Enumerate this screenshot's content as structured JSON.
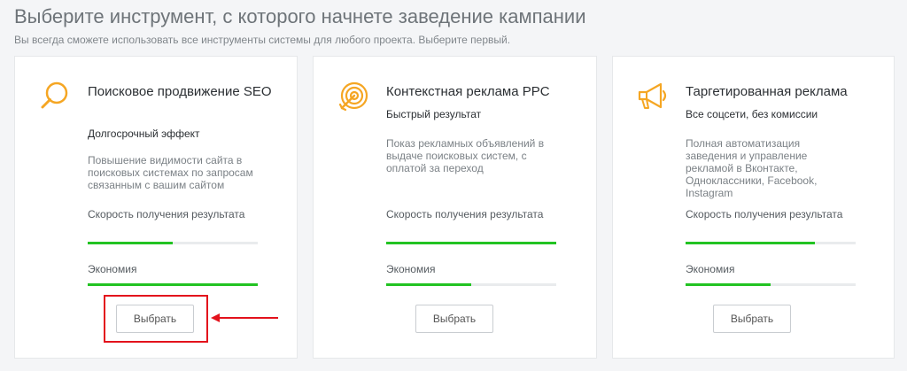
{
  "header": {
    "title": "Выберите инструмент, с которого начнете заведение кампании",
    "subtitle": "Вы всегда сможете использовать все инструменты системы для любого проекта. Выберите первый."
  },
  "colors": {
    "accent_orange": "#f5a623",
    "progress_green": "#22c322",
    "annotation_red": "#e3121c"
  },
  "cards": [
    {
      "icon": "search-icon",
      "title": "Поисковое продвижение SEO",
      "tagline": "Долгосрочный эффект",
      "description": "Повышение видимости сайта в поисковых системах по запросам связанным с вашим сайтом",
      "speed_label": "Скорость получения результата",
      "speed_value": 0.5,
      "economy_label": "Экономия",
      "economy_value": 1.0,
      "button_label": "Выбрать"
    },
    {
      "icon": "target-icon",
      "title": "Контекстная реклама PPC",
      "tagline": "Быстрый результат",
      "description": "Показ рекламных объявлений в выдаче поисковых систем, с оплатой за переход",
      "speed_label": "Скорость получения результата",
      "speed_value": 1.0,
      "economy_label": "Экономия",
      "economy_value": 0.5,
      "button_label": "Выбрать"
    },
    {
      "icon": "megaphone-icon",
      "title": "Таргетированная реклама",
      "tagline": "Все соцсети, без комиссии",
      "description": "Полная автоматизация заведения и управление рекламой в Вконтакте, Одноклассники, Facebook, Instagram",
      "speed_label": "Скорость получения результата",
      "speed_value": 0.76,
      "economy_label": "Экономия",
      "economy_value": 0.5,
      "button_label": "Выбрать"
    }
  ]
}
